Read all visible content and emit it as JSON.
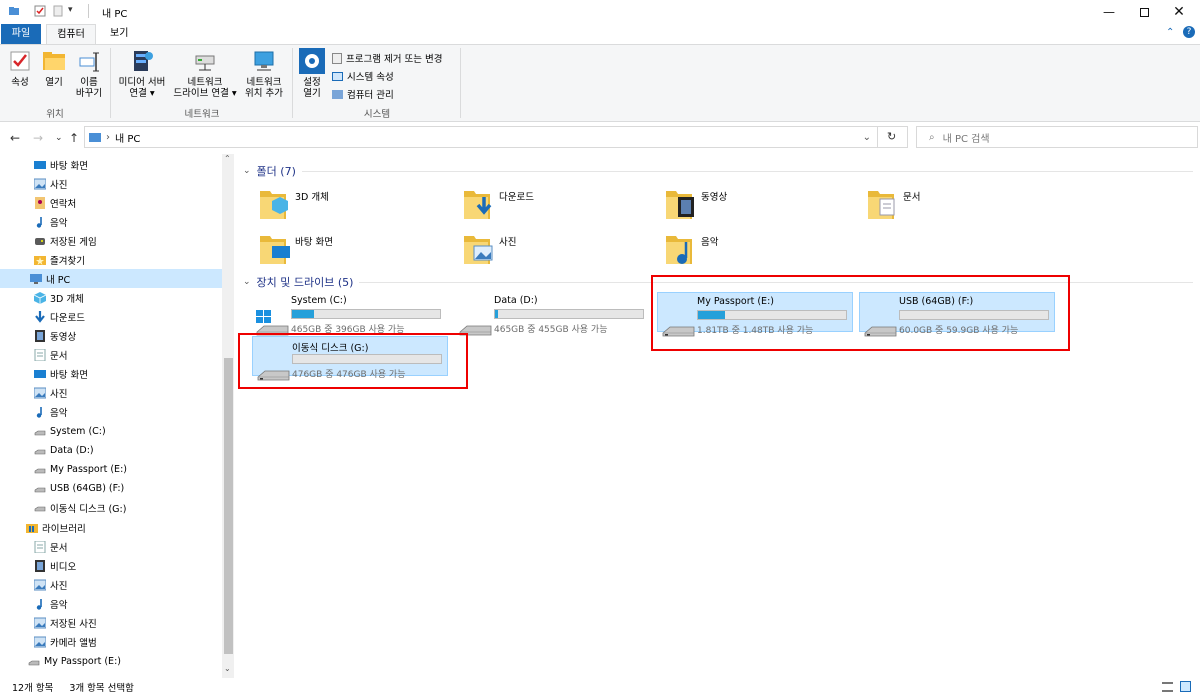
{
  "title": "내 PC",
  "tabs": {
    "file": "파일",
    "computer": "컴퓨터",
    "view": "보기"
  },
  "ribbon": {
    "properties": "속성",
    "open": "열기",
    "rename_1": "이름",
    "rename_2": "바꾸기",
    "location_group": "위치",
    "media_1": "미디어 서버",
    "media_2": "연결",
    "map_1": "네트워크",
    "map_2": "드라이브 연결",
    "addloc_1": "네트워크",
    "addloc_2": "위치 추가",
    "network_group": "네트워크",
    "settings_1": "설정",
    "settings_2": "열기",
    "uninstall": "프로그램 제거 또는 변경",
    "sysprops": "시스템 속성",
    "manage": "컴퓨터 관리",
    "system_group": "시스템"
  },
  "address": {
    "path": "내 PC",
    "search_placeholder": "내 PC 검색"
  },
  "sidebar": [
    {
      "label": "바탕 화면",
      "icon": "desktop-icon"
    },
    {
      "label": "사진",
      "icon": "pictures-icon"
    },
    {
      "label": "연락처",
      "icon": "contacts-icon"
    },
    {
      "label": "음악",
      "icon": "music-icon"
    },
    {
      "label": "저장된 게임",
      "icon": "games-icon"
    },
    {
      "label": "즐겨찾기",
      "icon": "favorites-icon"
    },
    {
      "label": "내 PC",
      "icon": "pc-icon"
    },
    {
      "label": "3D 개체",
      "icon": "3d-objects-icon"
    },
    {
      "label": "다운로드",
      "icon": "download-icon"
    },
    {
      "label": "동영상",
      "icon": "video-icon"
    },
    {
      "label": "문서",
      "icon": "documents-icon"
    },
    {
      "label": "바탕 화면",
      "icon": "desktop-icon"
    },
    {
      "label": "사진",
      "icon": "pictures-icon"
    },
    {
      "label": "음악",
      "icon": "music-icon"
    },
    {
      "label": "System (C:)",
      "icon": "drive-icon"
    },
    {
      "label": "Data (D:)",
      "icon": "drive-icon"
    },
    {
      "label": "My Passport (E:)",
      "icon": "drive-icon"
    },
    {
      "label": "USB (64GB) (F:)",
      "icon": "drive-icon"
    },
    {
      "label": "이동식 디스크 (G:)",
      "icon": "drive-icon"
    },
    {
      "label": "라이브러리",
      "icon": "library-icon"
    },
    {
      "label": "문서",
      "icon": "documents-icon"
    },
    {
      "label": "비디오",
      "icon": "video-icon"
    },
    {
      "label": "사진",
      "icon": "pictures-icon"
    },
    {
      "label": "음악",
      "icon": "music-icon"
    },
    {
      "label": "저장된 사진",
      "icon": "pictures-icon"
    },
    {
      "label": "카메라 앨범",
      "icon": "pictures-icon"
    },
    {
      "label": "My Passport (E:)",
      "icon": "drive-icon"
    }
  ],
  "folders_header": "폴더 (7)",
  "folders": [
    {
      "label": "3D 개체",
      "icon": "3d-objects-folder-icon"
    },
    {
      "label": "다운로드",
      "icon": "downloads-folder-icon"
    },
    {
      "label": "동영상",
      "icon": "videos-folder-icon"
    },
    {
      "label": "문서",
      "icon": "documents-folder-icon"
    },
    {
      "label": "바탕 화면",
      "icon": "desktop-folder-icon"
    },
    {
      "label": "사진",
      "icon": "pictures-folder-icon"
    },
    {
      "label": "음악",
      "icon": "music-folder-icon"
    }
  ],
  "drives_header": "장치 및 드라이브 (5)",
  "drives": [
    {
      "label": "System (C:)",
      "free": "465GB 중 396GB 사용 가능",
      "used_fraction": 0.15,
      "selected": false,
      "icon": "windows-drive-icon"
    },
    {
      "label": "Data (D:)",
      "free": "465GB 중 455GB 사용 가능",
      "used_fraction": 0.02,
      "selected": false,
      "icon": "hdd-icon"
    },
    {
      "label": "My Passport (E:)",
      "free": "1.81TB 중 1.48TB 사용 가능",
      "used_fraction": 0.18,
      "selected": true,
      "icon": "hdd-icon"
    },
    {
      "label": "USB (64GB) (F:)",
      "free": "60.0GB 중 59.9GB 사용 가능",
      "used_fraction": 0.0,
      "selected": true,
      "icon": "hdd-icon"
    },
    {
      "label": "이동식 디스크 (G:)",
      "free": "476GB 중 476GB 사용 가능",
      "used_fraction": 0.0,
      "selected": true,
      "icon": "hdd-icon"
    }
  ],
  "status": {
    "count": "12개 항목",
    "selected": "3개 항목 선택함"
  },
  "colors": {
    "accent": "#1a6bb8",
    "selection": "#cce8ff",
    "highlight": "#e00000",
    "folder": "#f8d775"
  }
}
